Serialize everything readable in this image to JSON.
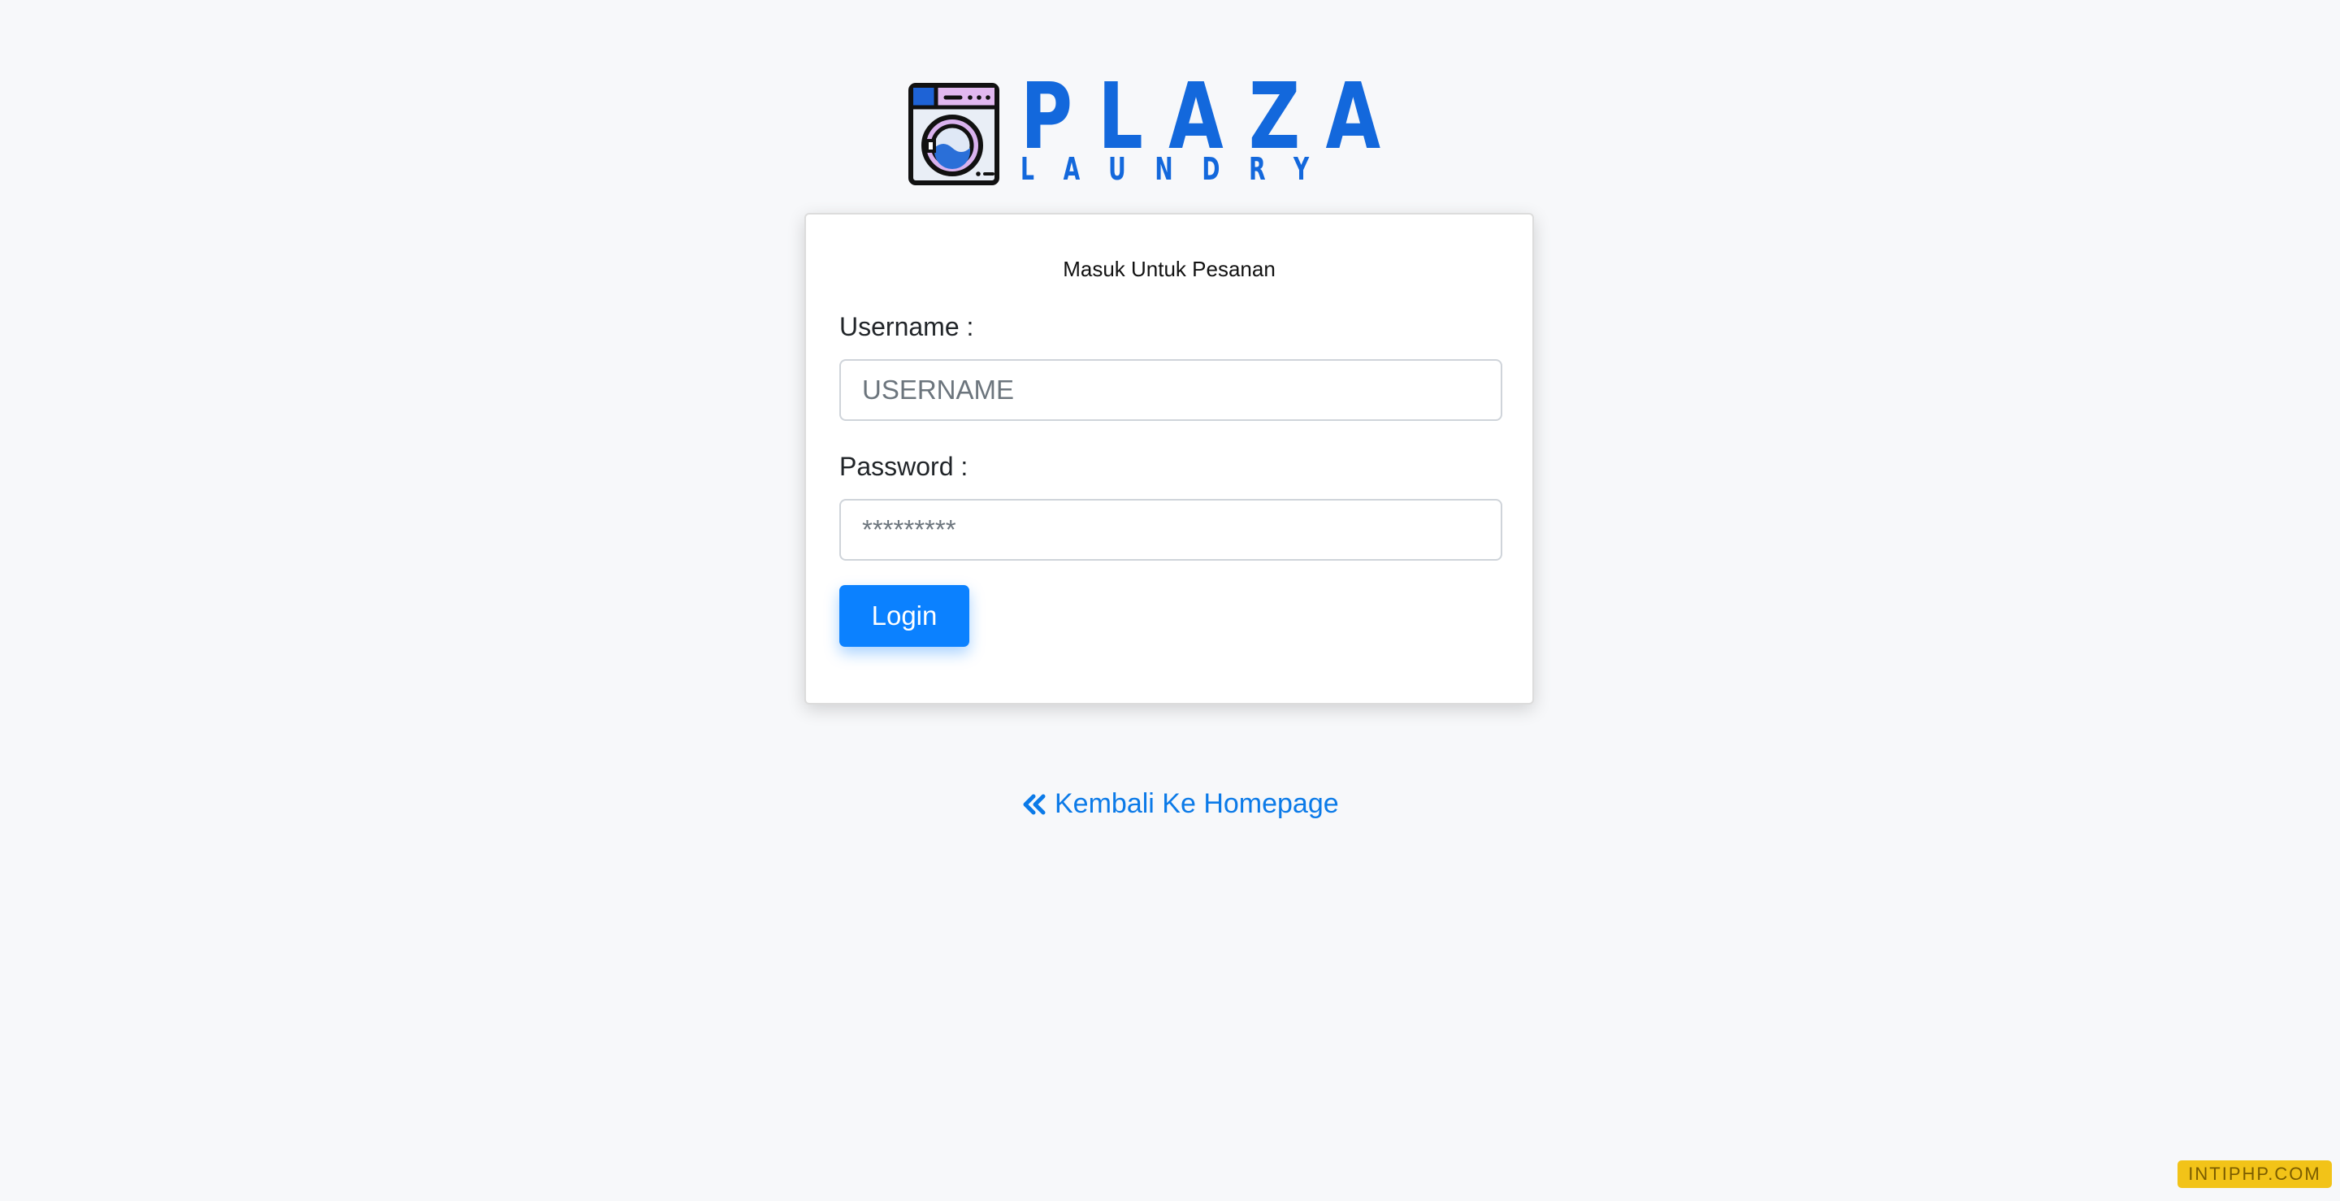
{
  "brand": {
    "name_top": "PLAZA",
    "name_bottom": "LAUNDRY",
    "logo_icon": "washing-machine-icon",
    "color": "#1368dc"
  },
  "login_card": {
    "title": "Masuk Untuk Pesanan",
    "username": {
      "label": "Username :",
      "placeholder": "USERNAME",
      "value": ""
    },
    "password": {
      "label": "Password :",
      "placeholder": "*********",
      "value": ""
    },
    "submit_label": "Login"
  },
  "back_link": {
    "icon": "double-chevron-left-icon",
    "label": "Kembali Ke Homepage"
  },
  "watermark": {
    "text": "INTIPHP.COM"
  },
  "colors": {
    "accent": "#0b81ff",
    "link": "#0b7ae8",
    "background": "#f7f8fa"
  }
}
